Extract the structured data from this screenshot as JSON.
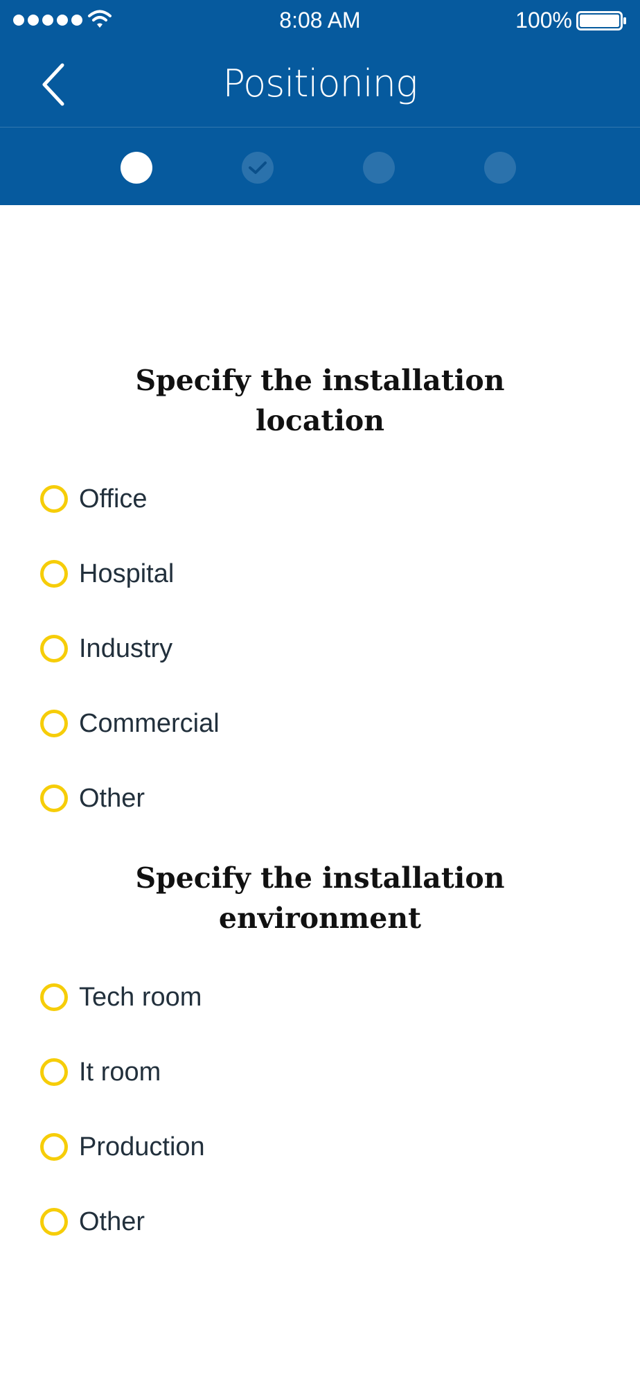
{
  "status_bar": {
    "time": "8:08 AM",
    "battery": "100%"
  },
  "nav": {
    "title": "Positioning"
  },
  "steps": [
    {
      "state": "active"
    },
    {
      "state": "completed"
    },
    {
      "state": "pending"
    },
    {
      "state": "pending"
    }
  ],
  "sections": [
    {
      "title": "Specify the installation location",
      "options": [
        "Office",
        "Hospital",
        "Industry",
        "Commercial",
        "Other"
      ]
    },
    {
      "title": "Specify the installation environment",
      "options": [
        "Tech room",
        "It room",
        "Production",
        "Other"
      ]
    }
  ],
  "colors": {
    "header": "#065a9e",
    "radio": "#f6cd09",
    "text": "#22303c"
  }
}
